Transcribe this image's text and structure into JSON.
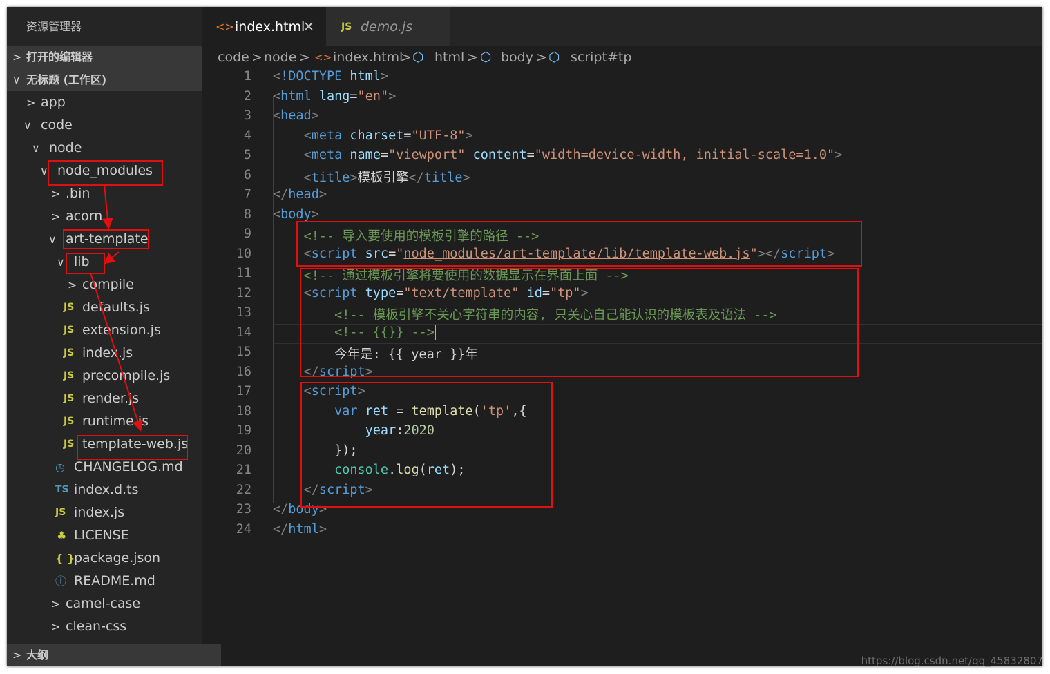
{
  "explorer": {
    "title": "资源管理器",
    "open_editors": "打开的编辑器",
    "workspace": "无标题 (工作区)",
    "tree": [
      "app",
      "code",
      "node",
      "node_modules",
      ".bin",
      "acorn",
      "art-template",
      "lib",
      "compile",
      "defaults.js",
      "extension.js",
      "index.js",
      "precompile.js",
      "render.js",
      "runtime.js",
      "template-web.js",
      "CHANGELOG.md",
      "index.d.ts",
      "index.js",
      "LICENSE",
      "package.json",
      "README.md",
      "camel-case",
      "clean-css"
    ],
    "outline": "大纲"
  },
  "tabs": [
    {
      "icon": "<>",
      "label": "index.html",
      "close": "✕"
    },
    {
      "icon": "JS",
      "label": "demo.js"
    }
  ],
  "breadcrumb": [
    "code",
    "node",
    "index.html",
    "html",
    "body",
    "script#tp"
  ],
  "line_numbers": [
    "1",
    "2",
    "3",
    "4",
    "5",
    "6",
    "7",
    "8",
    "9",
    "10",
    "11",
    "12",
    "13",
    "14",
    "15",
    "16",
    "17",
    "18",
    "19",
    "20",
    "21",
    "22",
    "23",
    "24"
  ],
  "code": {
    "l1_doctype": "!DOCTYPE",
    "l1_html": "html",
    "l2_tag": "html",
    "l2_attr": "lang",
    "l2_val": "\"en\"",
    "l3_tag": "head",
    "l4_tag": "meta",
    "l4_attr": "charset",
    "l4_val": "\"UTF-8\"",
    "l5_tag": "meta",
    "l5_attr1": "name",
    "l5_val1": "\"viewport\"",
    "l5_attr2": "content",
    "l5_val2": "\"width=device-width, initial-scale=1.0\"",
    "l6_tag": "title",
    "l6_text": "模板引擎",
    "l7_tag": "head",
    "l8_tag": "body",
    "l9_comment": "<!-- 导入要使用的模板引擎的路径 -->",
    "l10_tag": "script",
    "l10_attr": "src",
    "l10_val": "node_modules/art-template/lib/template-web.js",
    "l11_comment": "<!-- 通过模板引擎将要使用的数据显示在界面上面 -->",
    "l12_tag": "script",
    "l12_attr1": "type",
    "l12_val1": "\"text/template\"",
    "l12_attr2": "id",
    "l12_val2": "\"tp\"",
    "l13_comment": "<!-- 模板引擎不关心字符串的内容, 只关心自己能认识的模板表及语法 -->",
    "l14_comment": "<!-- {{}} -->",
    "l15_text": "今年是: {{ year }}年",
    "l16_tag": "script",
    "l17_tag": "script",
    "l18_kw": "var",
    "l18_var": "ret",
    "l18_eq": " = ",
    "l18_fn": "template",
    "l18_arg": "'tp'",
    "l19_key": "year",
    "l19_num": "2020",
    "l20_text": "});",
    "l21_obj": "console",
    "l21_fn": "log",
    "l21_arg": "ret",
    "l22_tag": "script",
    "l23_tag": "body",
    "l24_tag": "html"
  },
  "watermark": "https://blog.csdn.net/qq_45832807",
  "colors": {
    "annotation_red": "#e01010",
    "js_icon": "#cbcb41",
    "ts_icon": "#519aba",
    "html_icon": "#e37933"
  }
}
